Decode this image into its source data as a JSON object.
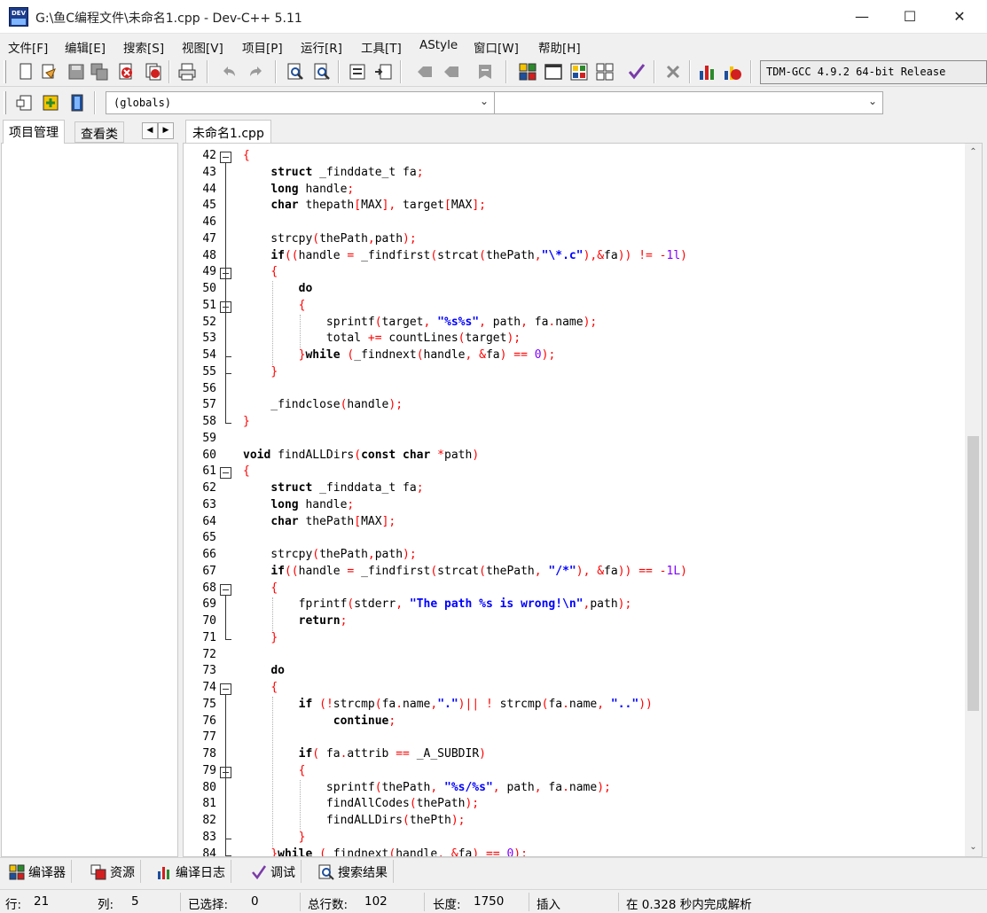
{
  "window": {
    "title": "G:\\鱼C编程文件\\未命名1.cpp - Dev-C++ 5.11",
    "app_icon_text": "DEV",
    "minimize": "—",
    "maximize": "☐",
    "close": "✕"
  },
  "menu": [
    "文件[F]",
    "编辑[E]",
    "搜索[S]",
    "视图[V]",
    "项目[P]",
    "运行[R]",
    "工具[T]",
    "AStyle",
    "窗口[W]",
    "帮助[H]"
  ],
  "toolbar": {
    "compiler": "TDM-GCC 4.9.2 64-bit Release",
    "scope_combo": "(globals)",
    "member_combo": ""
  },
  "left_panel": {
    "tabs": [
      "项目管理",
      "查看类"
    ],
    "nav_prev": "◀",
    "nav_next": "▶"
  },
  "editor": {
    "file_tab": "未命名1.cpp",
    "lines": [
      {
        "n": "42",
        "text": "{"
      },
      {
        "n": "43",
        "text": "    struct _finddate_t fa;"
      },
      {
        "n": "44",
        "text": "    long handle;"
      },
      {
        "n": "45",
        "text": "    char thepath[MAX], target[MAX];"
      },
      {
        "n": "46",
        "text": ""
      },
      {
        "n": "47",
        "text": "    strcpy(thePath,path);"
      },
      {
        "n": "48",
        "text": "    if((handle = _findfirst(strcat(thePath,\"\\*.c\"),&fa)) != -1l)"
      },
      {
        "n": "49",
        "text": "    {"
      },
      {
        "n": "50",
        "text": "        do"
      },
      {
        "n": "51",
        "text": "        {"
      },
      {
        "n": "52",
        "text": "            sprintf(target, \"%s%s\", path, fa.name);"
      },
      {
        "n": "53",
        "text": "            total += countLines(target);"
      },
      {
        "n": "54",
        "text": "        }while (_findnext(handle, &fa) == 0);"
      },
      {
        "n": "55",
        "text": "    }"
      },
      {
        "n": "56",
        "text": ""
      },
      {
        "n": "57",
        "text": "    _findclose(handle);"
      },
      {
        "n": "58",
        "text": "}"
      },
      {
        "n": "59",
        "text": ""
      },
      {
        "n": "60",
        "text": "void findALLDirs(const char *path)"
      },
      {
        "n": "61",
        "text": "{"
      },
      {
        "n": "62",
        "text": "    struct _finddata_t fa;"
      },
      {
        "n": "63",
        "text": "    long handle;"
      },
      {
        "n": "64",
        "text": "    char thePath[MAX];"
      },
      {
        "n": "65",
        "text": ""
      },
      {
        "n": "66",
        "text": "    strcpy(thePath,path);"
      },
      {
        "n": "67",
        "text": "    if((handle = _findfirst(strcat(thePath, \"/*\"), &fa)) == -1L)"
      },
      {
        "n": "68",
        "text": "    {"
      },
      {
        "n": "69",
        "text": "        fprintf(stderr, \"The path %s is wrong!\\n\",path);"
      },
      {
        "n": "70",
        "text": "        return;"
      },
      {
        "n": "71",
        "text": "    }"
      },
      {
        "n": "72",
        "text": ""
      },
      {
        "n": "73",
        "text": "    do"
      },
      {
        "n": "74",
        "text": "    {"
      },
      {
        "n": "75",
        "text": "        if (!strcmp(fa.name,\".\")|| ! strcmp(fa.name, \"..\"))"
      },
      {
        "n": "76",
        "text": "             continue;"
      },
      {
        "n": "77",
        "text": ""
      },
      {
        "n": "78",
        "text": "        if( fa.attrib == _A_SUBDIR)"
      },
      {
        "n": "79",
        "text": "        {"
      },
      {
        "n": "80",
        "text": "            sprintf(thePath, \"%s/%s\", path, fa.name);"
      },
      {
        "n": "81",
        "text": "            findAllCodes(thePath);"
      },
      {
        "n": "82",
        "text": "            findALLDirs(thePth);"
      },
      {
        "n": "83",
        "text": "        }"
      },
      {
        "n": "84",
        "text": "    }while (_findnext(handle, &fa) == 0);"
      }
    ]
  },
  "bottom_tabs": [
    "编译器",
    "资源",
    "编译日志",
    "调试",
    "搜索结果"
  ],
  "status": {
    "row_label": "行:",
    "row": "21",
    "col_label": "列:",
    "col": "5",
    "sel_label": "已选择:",
    "sel": "0",
    "total_label": "总行数:",
    "total": "102",
    "len_label": "长度:",
    "len": "1750",
    "mode": "插入",
    "parse": "在 0.328 秒内完成解析"
  }
}
